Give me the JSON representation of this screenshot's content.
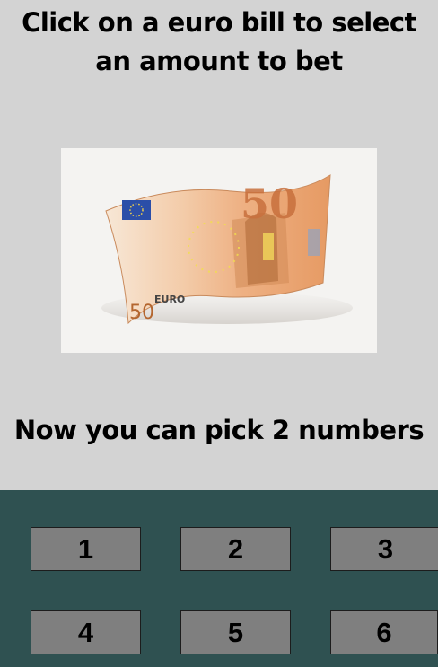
{
  "instruction": "Click on a euro bill to select an amount to bet",
  "bill": {
    "denomination": "50",
    "currency_label": "EURO",
    "accent_color": "#e8a068"
  },
  "pick_message": "Now you can pick 2 numbers",
  "numbers": [
    "1",
    "2",
    "3",
    "4",
    "5",
    "6"
  ],
  "colors": {
    "background": "#d3d3d3",
    "board": "#2f5151",
    "button": "#7f7f7f"
  }
}
